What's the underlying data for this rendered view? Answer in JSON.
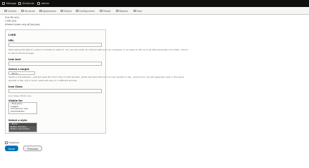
{
  "toolbar": {
    "items": [
      {
        "label": "Manage"
      },
      {
        "label": "Shortcuts"
      },
      {
        "label": "admin"
      }
    ]
  },
  "tray": {
    "items": [
      {
        "label": "Content"
      },
      {
        "label": "Structure"
      },
      {
        "label": "Appearance"
      },
      {
        "label": "Extend"
      },
      {
        "label": "Configuration"
      },
      {
        "label": "People"
      },
      {
        "label": "Reports"
      },
      {
        "label": "Help"
      }
    ]
  },
  "upload_help": {
    "line1": "One file only.",
    "line2": "2 MB limit.",
    "line3": "Allowed types: png gif jpg jpeg."
  },
  "link": {
    "legend": "LINK",
    "url_label": "URL",
    "url_value": "",
    "url_description": "Start typing the title of a piece of content to select it. You can also enter an internal path such as /node/add or an external URL such as http://example.com. Enter <front> to link to the front page.",
    "link_text_label": "Link text",
    "link_text_value": "",
    "target_label": "Select a target",
    "target_selected": "- None -",
    "target_description": "Select a link behavior. _self will open the link in the current window. _blank will open the link in a new window or tab. _parent and _top will generally open in the same window or tab, but in some cases will open in a different window.",
    "icon_class_label": "Icon Class",
    "icon_class_value": "",
    "icon_class_description": "Icon Class, fill for icon",
    "visible_for_label": "Visible for",
    "visible_for_options": [
      "- Everyone -",
      "Logged",
      "Anonymous user",
      "Administrator"
    ],
    "style_label": "Select a style",
    "style_options": [
      "- None -",
      "Button Primary",
      "Button Secondary"
    ]
  },
  "published": {
    "label": "Published",
    "checked": false
  },
  "actions": {
    "save": "Save",
    "preview": "Preview"
  }
}
